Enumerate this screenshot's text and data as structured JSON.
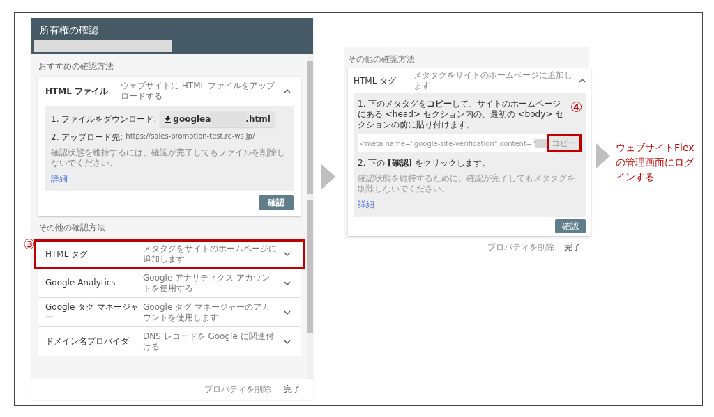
{
  "left_dialog": {
    "title": "所有権の確認",
    "recommended_heading": "おすすめの確認方法",
    "recommended": {
      "name": "HTML ファイル",
      "description": "ウェブサイトに HTML ファイルをアップロードする",
      "expanded": true,
      "download_label": "1. ファイルをダウンロード:",
      "download_prefix": "googlea",
      "download_suffix": ".html",
      "upload_label": "2. アップロード先:",
      "upload_url": "https://sales-promotion-test.re-ws.jp/",
      "note": "確認状態を維持するには、確認が完了してもファイルを削除しないでください。",
      "link": "詳細",
      "confirm": "確認"
    },
    "other_heading": "その他の確認方法",
    "methods": [
      {
        "name": "HTML タグ",
        "description": "メタタグをサイトのホームページに追加します",
        "expanded": false,
        "highlighted": true
      },
      {
        "name": "Google Analytics",
        "description": "Google アナリティクス アカウントを使用する",
        "expanded": false,
        "highlighted": false
      },
      {
        "name": "Google タグ マネージャー",
        "description": "Google タグ マネージャーのアカウントを使用します",
        "expanded": false,
        "highlighted": false
      },
      {
        "name": "ドメイン名プロバイダ",
        "description": "DNS レコードを Google に関連付ける",
        "expanded": false,
        "highlighted": false
      }
    ],
    "footer": [
      "プロパティを削除",
      "完了"
    ]
  },
  "left_marker": "③",
  "right_dialog": {
    "heading": "その他の確認方法",
    "name": "HTML タグ",
    "description": "メタタグをサイトのホームページに追加します",
    "expanded": true,
    "step1": "1. 下のメタタグを**コピー**して、サイトのホームページにある <head> セクション内の、最初の <body> セクションの前に貼り付けます。",
    "meta": "<meta name=\"google-site-verification\" content=\"",
    "copy": "コピー",
    "copy_highlighted": true,
    "step2": "2. 下の **[確認]** をクリックします。",
    "note": "確認状態を維持するために、確認が完了してもメタタグを削除しないでください。",
    "link": "詳細",
    "confirm": "確認",
    "footer": [
      "プロパティを削除",
      "完了"
    ]
  },
  "right_marker": "④",
  "caption": "ウェブサイトFlexの管理画面にログインする"
}
